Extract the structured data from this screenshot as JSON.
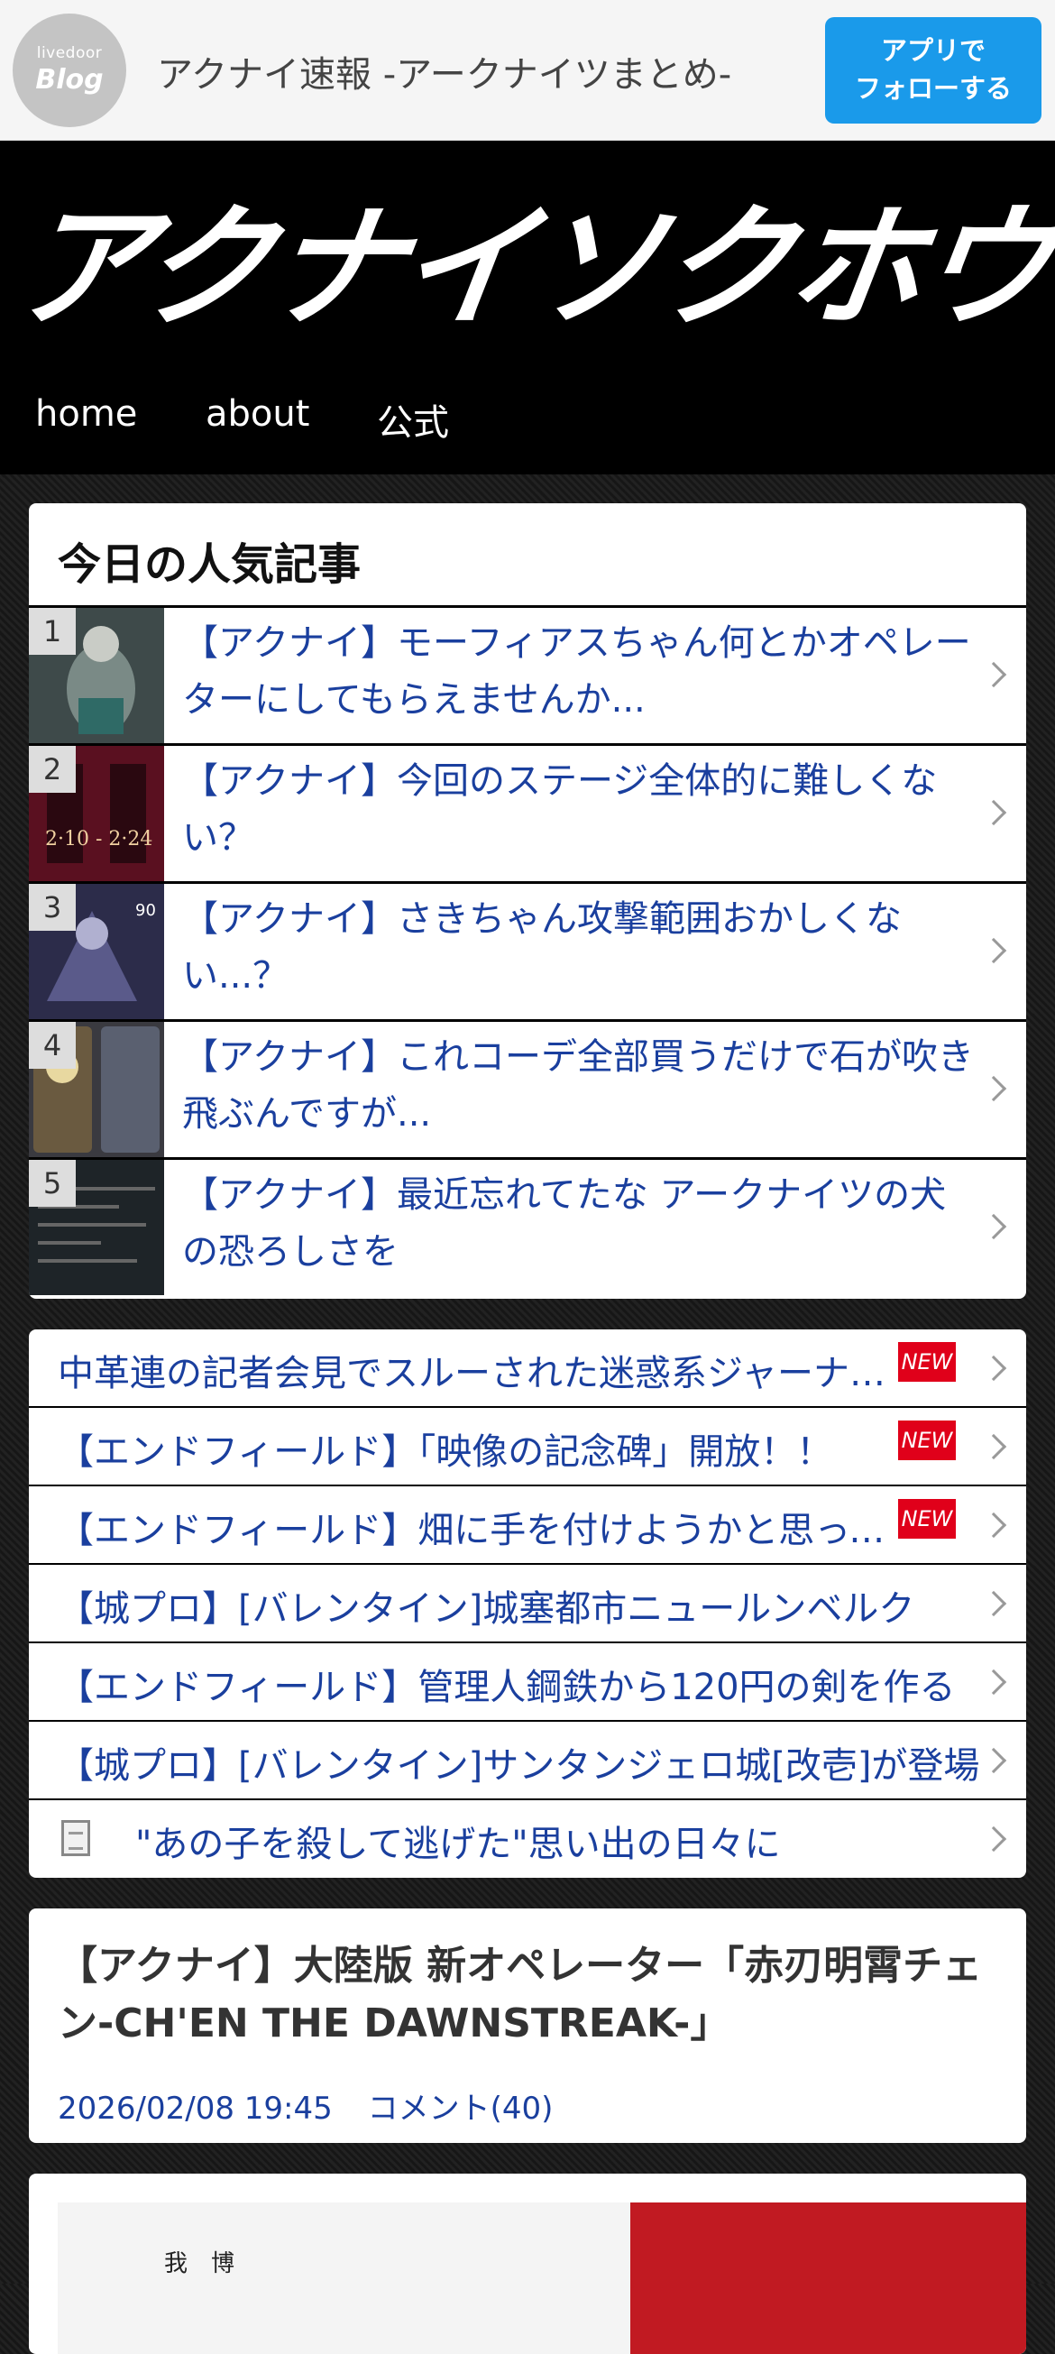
{
  "appbar": {
    "logo_top": "livedoor",
    "logo_bottom": "Blog",
    "blog_name": "アクナイ速報 -アークナイツまとめ-",
    "follow_line1": "アプリで",
    "follow_line2": "フォローする"
  },
  "header": {
    "site_logo": "アクナイソクホウ",
    "nav": [
      "home",
      "about",
      "公式"
    ]
  },
  "ranking": {
    "heading": "今日の人気記事",
    "items": [
      {
        "rank": "1",
        "title": "【アクナイ】モーフィアスちゃん何とかオペレーターにしてもらえませんか..."
      },
      {
        "rank": "2",
        "title": "【アクナイ】今回のステージ全体的に難しくない？"
      },
      {
        "rank": "3",
        "title": "【アクナイ】さきちゃん攻撃範囲おかしくない...？"
      },
      {
        "rank": "4",
        "title": "【アクナイ】これコーデ全部買うだけで石が吹き飛ぶんですが..."
      },
      {
        "rank": "5",
        "title": "【アクナイ】最近忘れてたな アークナイツの犬の恐ろしさを"
      }
    ],
    "thumb_colors": [
      "#3e4a4a",
      "#5a1020",
      "#2c2c4a",
      "#3a3a40",
      "#1e2428"
    ]
  },
  "list": {
    "items": [
      {
        "text": "中革連の記者会見でスルーされた迷惑系ジャーナリスト",
        "new": true
      },
      {
        "text": "【エンドフィールド】「映像の記念碑」開放！！",
        "new": true
      },
      {
        "text": "【エンドフィールド】畑に手を付けようかと思ってるんだけど",
        "new": true
      },
      {
        "text": "【城プロ】[バレンタイン]城塞都市ニュールンベルク",
        "new": false
      },
      {
        "text": "【エンドフィールド】管理人鋼鉄から120円の剣を作る",
        "new": false
      },
      {
        "text": "【城プロ】[バレンタイン]サンタンジェロ城[改壱]が登場",
        "new": false
      },
      {
        "text": "\"あの子を殺して逃げた\"思い出の日々に",
        "new": false,
        "doc_icon": true
      }
    ],
    "new_badge": "NEW"
  },
  "article": {
    "title": "【アクナイ】大陸版 新オペレーター「赤刃明霄チェン-CH'EN THE DAWNSTREAK-」",
    "date": "2026/02/08 19:45",
    "comments": "コメント(40)"
  },
  "image": {
    "text_line1": "我　博"
  }
}
